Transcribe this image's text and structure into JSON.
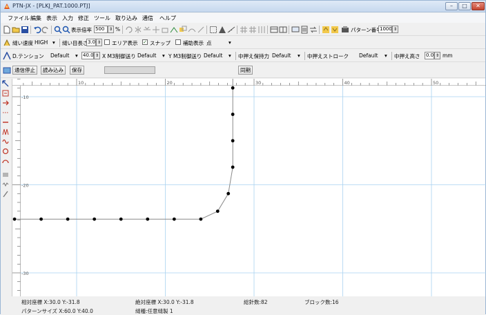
{
  "window": {
    "title": "PTN-JX - [PLKJ_PAT.1000.PTJ]",
    "controls": [
      "–",
      "□",
      "✕"
    ]
  },
  "menu": [
    "ファイル",
    "編集",
    "表示",
    "入力",
    "修正",
    "ツール",
    "取り込み",
    "通信",
    "ヘルプ"
  ],
  "toolbar1": {
    "zoom_label": "表示倍率",
    "zoom_value": "500",
    "zoom_unit": "%",
    "pattern_label": "パターン番号",
    "pattern_value": "1000"
  },
  "toolbar2": {
    "speed_label": "縫い速度",
    "speed_value": "HIGH",
    "stitch_label": "縫い目長さ",
    "stitch_value": "3.0",
    "area_label": "エリア表示",
    "snap_label": "スナップ",
    "snap_checked": true,
    "ref_label": "補助表示",
    "ref_value": "点"
  },
  "toolbar3": {
    "tension_label": "D.テンション",
    "tension_value": "Default",
    "tension_num": "40.0",
    "xm3_label": "X M3制御送り",
    "xm3_value": "Default",
    "ym3_label": "Y M3制御送り",
    "ym3_value": "Default",
    "press_label": "中押え保持力",
    "press_value": "Default",
    "stroke_label": "中押えストローク",
    "stroke_value": "Default",
    "height_label": "中押え高さ",
    "height_value": "0.0",
    "height_unit": "mm"
  },
  "toolbar4": {
    "stop_label": "通信停止",
    "load_label": "読み込み",
    "save_label": "保存",
    "sync_label": "同期",
    "progress": 0
  },
  "canvas": {
    "ruler_x_labels": [
      "10",
      "20",
      "30",
      "40",
      "50"
    ],
    "ruler_y_labels": [
      "-10",
      "-20",
      "-30"
    ]
  },
  "status": {
    "rel_coord": "相対座標 X:30.0 Y:-31.8",
    "abs_coord": "絶対座標 X:30.0 Y:-31.8",
    "stitches": "総針数:82",
    "blocks": "ブロック数:16",
    "pattern_size": "パターンサイズ X:60.0 Y:40.0",
    "stitch_type": "縫種:任意縫製 1"
  },
  "colors": {
    "accent": "#e2561f",
    "grid": "#a9d2f0",
    "line": "#8a8a8a",
    "point": "#000000"
  }
}
